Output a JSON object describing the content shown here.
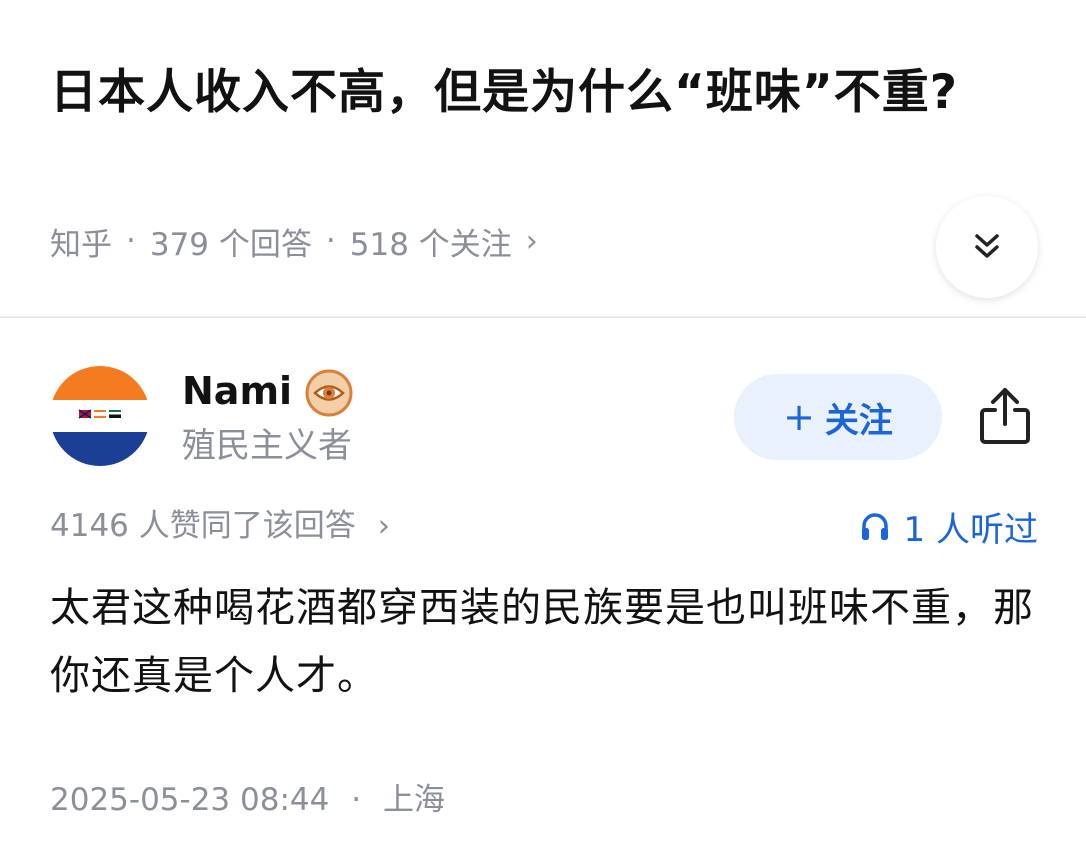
{
  "question": {
    "title": "日本人收入不高，但是为什么“班味”不重?",
    "source": "知乎",
    "separator": "·",
    "answers": "379 个回答",
    "followers": "518 个关注",
    "meta_chevron": "›"
  },
  "header": {
    "expand_icon": "double-chevron-down-icon"
  },
  "author": {
    "name": "Nami",
    "bio": "殖民主义者",
    "avatar_icon": "flag-avatar",
    "badge_icon": "eye-badge-icon"
  },
  "follow_button": {
    "plus": "+",
    "label": "关注"
  },
  "share_icon": "share-icon",
  "answer": {
    "votes": "4146 人赞同了该回答",
    "votes_chevron": "›",
    "listen": "1 人听过",
    "listen_icon": "headphones-icon",
    "content": "太君这种喝花酒都穿西装的民族要是也叫班味不重，那你还真是个人才。",
    "date": "2025-05-23 08:44",
    "separator": "·",
    "location": "上海"
  },
  "colors": {
    "accent": "#1a66d8",
    "muted": "#8a8f99",
    "follow_bg": "#e9f1fc",
    "flag_orange": "#f47b20",
    "flag_white": "#ffffff",
    "flag_blue": "#1b3f94"
  }
}
